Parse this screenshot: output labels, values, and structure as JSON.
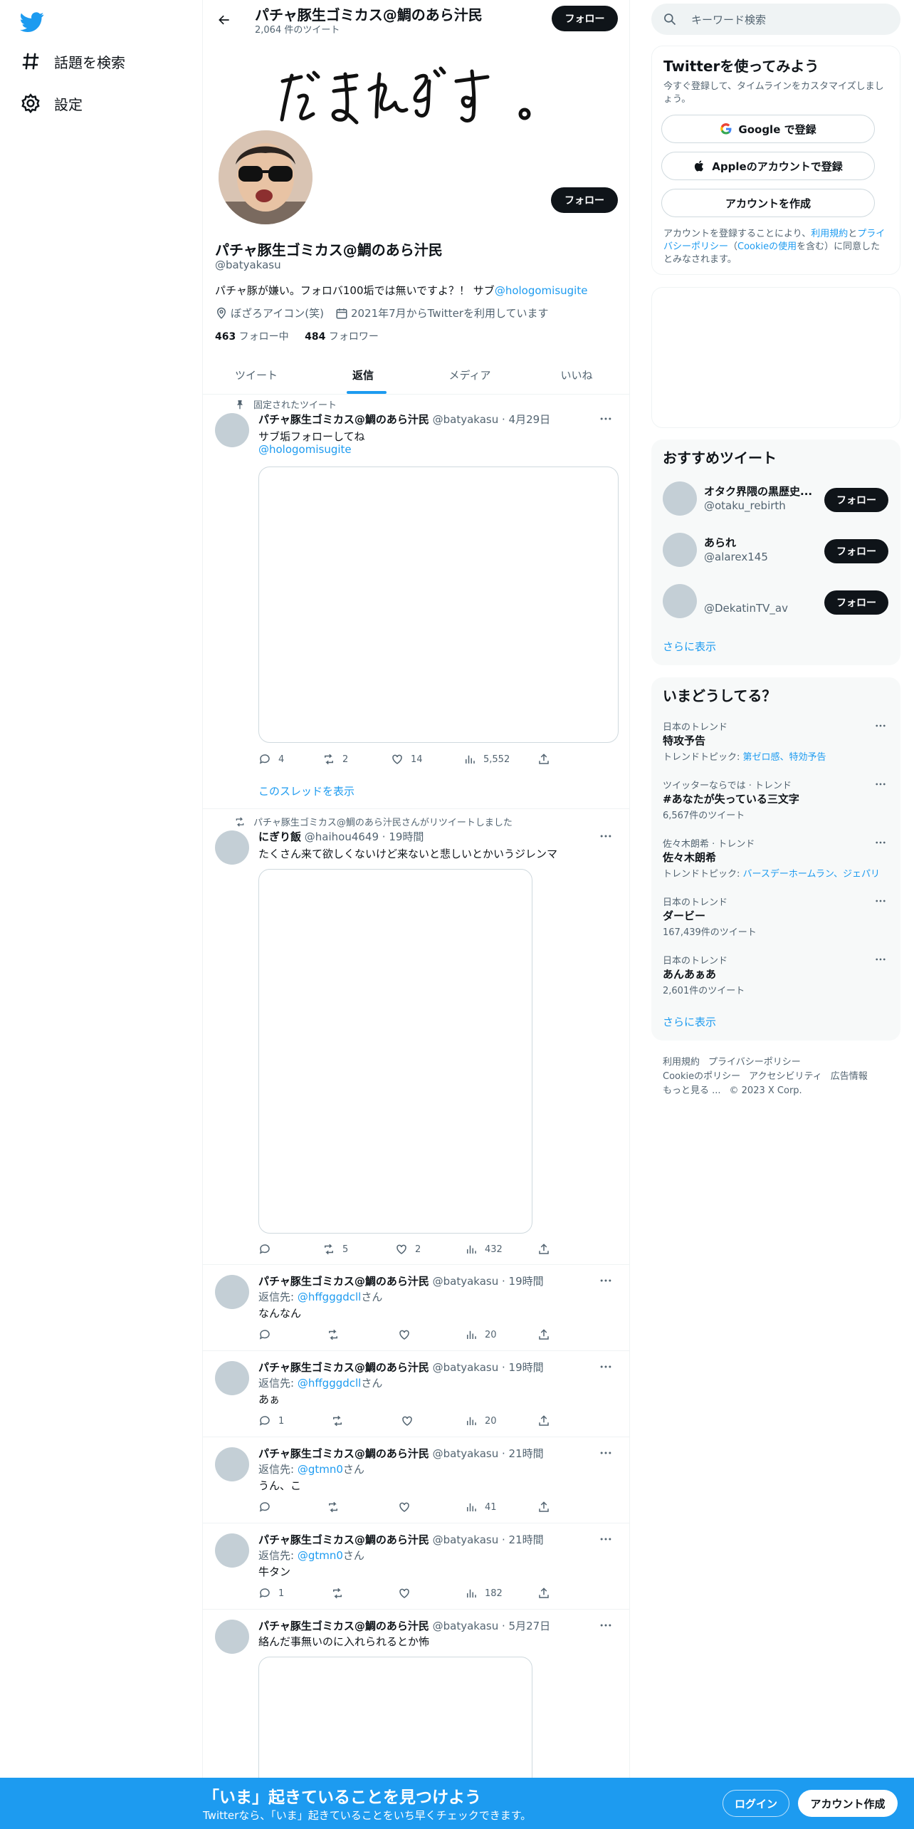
{
  "colors": {
    "accent": "#1d9bf0",
    "text": "#0f1419",
    "muted": "#536471",
    "border": "#eff3f4"
  },
  "nav": {
    "items": [
      {
        "label": "話題を検索",
        "icon": "hashtag-icon"
      },
      {
        "label": "設定",
        "icon": "gear-icon"
      }
    ]
  },
  "header": {
    "name": "パチャ豚生ゴミカス@鯛のあら汁民",
    "tweet_count": "2,064 件のツイート",
    "follow_label": "フォロー"
  },
  "profile": {
    "name": "パチャ豚生ゴミカス@鯛のあら汁民",
    "handle": "@batyakasu",
    "bio_text": "パチャ豚が嫌い。フォロバ100垢では無いですよ？！ サブ",
    "bio_link": "@hologomisugite",
    "location": "ぼざろアイコン(笑)",
    "joined": "2021年7月からTwitterを利用しています",
    "following_count": "463",
    "following_label": " フォロー中",
    "followers_count": "484",
    "followers_label": " フォロワー",
    "follow_label": "フォロー"
  },
  "tabs": [
    {
      "label": "ツイート"
    },
    {
      "label": "返信"
    },
    {
      "label": "メディア"
    },
    {
      "label": "いいね"
    }
  ],
  "tweets": [
    {
      "social": "固定されたツイート",
      "name": "パチャ豚生ゴミカス@鯛のあら汁民",
      "meta": " @batyakasu · 4月29日",
      "text": "サブ垢フォローしてね",
      "link": "@hologomisugite",
      "actions": {
        "reply": "4",
        "retweet": "2",
        "like": "14",
        "views": "5,552"
      },
      "thread_link": "このスレッドを表示"
    },
    {
      "social": "パチャ豚生ゴミカス@鯛のあら汁民さんがリツイートしました",
      "name": "にぎり飯",
      "meta": " @haihou4649 · 19時間",
      "text": "たくさん来て欲しくないけど来ないと悲しいとかいうジレンマ",
      "actions": {
        "reply": "",
        "retweet": "5",
        "like": "2",
        "views": "432"
      }
    },
    {
      "name": "パチャ豚生ゴミカス@鯛のあら汁民",
      "meta": " @batyakasu · 19時間",
      "reply_prefix": "返信先: ",
      "reply_to": "@hffgggdcll",
      "reply_suffix": "さん",
      "text": "なんなん",
      "actions": {
        "reply": "",
        "retweet": "",
        "like": "",
        "views": "20"
      }
    },
    {
      "name": "パチャ豚生ゴミカス@鯛のあら汁民",
      "meta": " @batyakasu · 19時間",
      "reply_prefix": "返信先: ",
      "reply_to": "@hffgggdcll",
      "reply_suffix": "さん",
      "text": "あぁ",
      "actions": {
        "reply": "1",
        "retweet": "",
        "like": "",
        "views": "20"
      }
    },
    {
      "name": "パチャ豚生ゴミカス@鯛のあら汁民",
      "meta": " @batyakasu · 21時間",
      "reply_prefix": "返信先: ",
      "reply_to": "@gtmn0",
      "reply_suffix": "さん",
      "text": "うん、こ",
      "actions": {
        "reply": "",
        "retweet": "",
        "like": "",
        "views": "41"
      }
    },
    {
      "name": "パチャ豚生ゴミカス@鯛のあら汁民",
      "meta": " @batyakasu · 21時間",
      "reply_prefix": "返信先: ",
      "reply_to": "@gtmn0",
      "reply_suffix": "さん",
      "text": "牛タン",
      "actions": {
        "reply": "1",
        "retweet": "",
        "like": "",
        "views": "182"
      }
    },
    {
      "name": "パチャ豚生ゴミカス@鯛のあら汁民",
      "meta": " @batyakasu · 5月27日",
      "text": "絡んだ事無いのに入れられるとか怖"
    }
  ],
  "search": {
    "placeholder": "キーワード検索"
  },
  "signup": {
    "title": "Twitterを使ってみよう",
    "subtitle": "今すぐ登録して、タイムラインをカスタマイズしましょう。",
    "google": "Google で登録",
    "apple": "Appleのアカウントで登録",
    "create": "アカウントを作成",
    "terms_1": "アカウントを登録することにより、",
    "terms_link_1": "利用規約",
    "terms_2": "と",
    "terms_link_2": "プライバシーポリシー",
    "terms_3": "（",
    "terms_link_3": "Cookieの使用",
    "terms_4": "を含む）に同意したとみなされます。"
  },
  "recommended": {
    "title": "おすすめツイート",
    "accounts": [
      {
        "name": "オタク界隈の黒歴史...",
        "handle": "@otaku_rebirth"
      },
      {
        "name": "あられ",
        "handle": "@alarex145"
      },
      {
        "name": "",
        "handle": "@DekatinTV_av"
      }
    ],
    "follow_label": "フォロー",
    "show_more": "さらに表示"
  },
  "trends": {
    "title": "いまどうしてる？",
    "items": [
      {
        "category": "日本のトレンド",
        "name": "特攻予告",
        "extra_prefix": "トレンドトピック: ",
        "extra_links": "第ゼロ感、特効予告"
      },
      {
        "category": "ツイッターならでは · トレンド",
        "name": "#あなたが失っている三文字",
        "extra": "6,567件のツイート"
      },
      {
        "category": "佐々木朗希 · トレンド",
        "name": "佐々木朗希",
        "extra_prefix": "トレンドトピック: ",
        "extra_links": "バースデーホームラン、ジェパリ"
      },
      {
        "category": "日本のトレンド",
        "name": "ダービー",
        "extra": "167,439件のツイート"
      },
      {
        "category": "日本のトレンド",
        "name": "あんあぁあ",
        "extra": "2,601件のツイート"
      }
    ],
    "show_more": "さらに表示"
  },
  "footer": {
    "links_row1": [
      "利用規約",
      "プライバシーポリシー"
    ],
    "links_row2": [
      "Cookieのポリシー",
      "アクセシビリティ",
      "広告情報"
    ],
    "more": "もっと見る ...",
    "copyright": "© 2023 X Corp."
  },
  "bottom_bar": {
    "title": "「いま」起きていることを見つけよう",
    "subtitle": "Twitterなら、「いま」起きていることをいち早くチェックできます。",
    "login": "ログイン",
    "signup": "アカウント作成"
  }
}
